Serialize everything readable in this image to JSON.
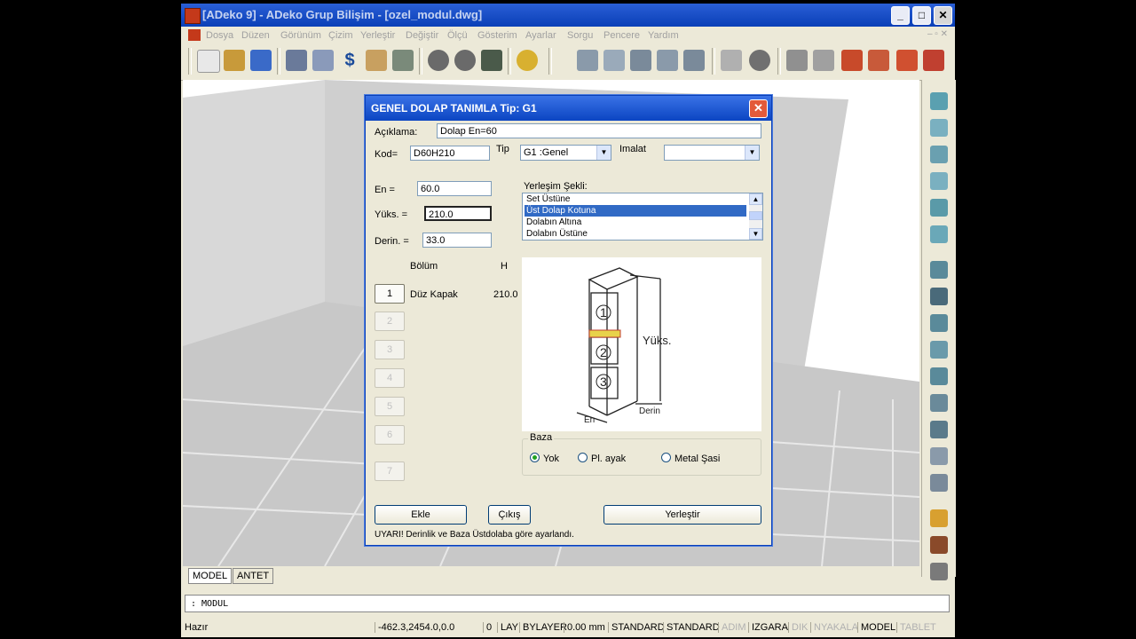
{
  "window": {
    "title": "[ADeko 9] - ADeko Grup Bilişim - [ozel_modul.dwg]"
  },
  "menu": [
    "Dosya",
    "Düzen",
    "Görünüm",
    "Çizim",
    "Yerleştir",
    "Değiştir",
    "Ölçü",
    "Gösterim",
    "Ayarlar",
    "Sorgu",
    "Pencere",
    "Yardım"
  ],
  "tabs": {
    "model": "MODEL",
    "antet": "ANTET"
  },
  "command_line": ": MODUL",
  "status": {
    "ready": "Hazır",
    "coords": "-462.3,2454.0,0.0",
    "layer_num": "0",
    "lay": "LAY",
    "bylayer": "BYLAYER",
    "mm": "0.00 mm",
    "std1": "STANDARD",
    "std2": "STANDARD",
    "adim": "ADIM",
    "izgara": "IZGARA",
    "dik": "DIK",
    "nyakala": "NYAKALA",
    "model": "MODEL",
    "tablet": "TABLET"
  },
  "dialog": {
    "title": "GENEL DOLAP TANIMLA Tip: G1",
    "aciklama_label": "Açıklama:",
    "aciklama_value": "Dolap En=60",
    "kod_label": "Kod=",
    "kod_value": "D60H210",
    "tip_label": "Tip",
    "tip_value": "G1 :Genel",
    "imalat_label": "Imalat",
    "imalat_value": "",
    "en_label": "En   =",
    "en_value": "60.0",
    "yuks_label": "Yüks. =",
    "yuks_value": "210.0",
    "derin_label": "Derin. =",
    "derin_value": "33.0",
    "yerlesim_label": "Yerleşim Şekli:",
    "yerlesim_items": [
      "Set Üstüne",
      "Üst Dolap Kotuna",
      "Dolabın Altına",
      "Dolabın Üstüne"
    ],
    "yerlesim_selected": 1,
    "bolum_header": "Bölüm",
    "h_header": "H",
    "sections": [
      "1",
      "2",
      "3",
      "4",
      "5",
      "6",
      "7"
    ],
    "section1_name": "Düz Kapak",
    "section1_h": "210.0",
    "preview": {
      "yuks_text": "Yüks.",
      "en_text": "En",
      "derin_text": "Derin",
      "labels": [
        "1",
        "2",
        "3"
      ]
    },
    "baza_label": "Baza",
    "baza_options": [
      "Yok",
      "Pl. ayak",
      "Metal Şasi"
    ],
    "baza_selected": 0,
    "ekle_label": "Ekle",
    "cikis_label": "Çıkış",
    "yerlestir_label": "Yerleştir",
    "warning": "UYARI! Derinlik ve Baza Üstdolaba göre ayarlandı."
  },
  "colors": {
    "titlebar": "#0b45c2",
    "selection": "#316ac5",
    "panel": "#ece9d8"
  }
}
